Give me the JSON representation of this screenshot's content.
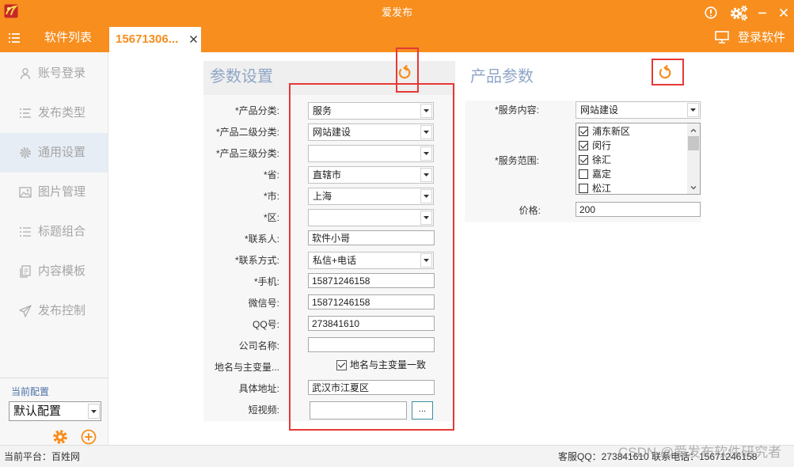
{
  "window": {
    "title": "爱发布",
    "accent_color": "#f78e1e",
    "annotation_color": "#e53935"
  },
  "topbar": {
    "list_label": "软件列表",
    "active_tab_label": "15671306...",
    "login_label": "登录软件"
  },
  "sidebar": {
    "active_index": 2,
    "items": [
      {
        "label": "账号登录",
        "icon": "user-icon"
      },
      {
        "label": "发布类型",
        "icon": "list-check-icon"
      },
      {
        "label": "通用设置",
        "icon": "gear-icon"
      },
      {
        "label": "图片管理",
        "icon": "image-icon"
      },
      {
        "label": "标题组合",
        "icon": "list-icon"
      },
      {
        "label": "内容模板",
        "icon": "document-icon"
      },
      {
        "label": "发布控制",
        "icon": "send-icon"
      }
    ],
    "config_label": "当前配置",
    "config_value": "默认配置"
  },
  "params_panel": {
    "title": "参数设置",
    "fields": [
      {
        "label": "*产品分类:",
        "value": "服务"
      },
      {
        "label": "*产品二级分类:",
        "value": "网站建设"
      },
      {
        "label": "*产品三级分类:",
        "value": ""
      },
      {
        "label": "*省:",
        "value": "直辖市"
      },
      {
        "label": "*市:",
        "value": "上海"
      },
      {
        "label": "*区:",
        "value": ""
      },
      {
        "label": "*联系人:",
        "value": "软件小哥"
      },
      {
        "label": "*联系方式:",
        "value": "私信+电话"
      },
      {
        "label": "*手机:",
        "value": "15871246158"
      },
      {
        "label": "微信号:",
        "value": "15871246158"
      },
      {
        "label": "QQ号:",
        "value": "273841610"
      },
      {
        "label": "公司名称:",
        "value": ""
      },
      {
        "label": "地名与主变量...",
        "checkbox_label": "地名与主变量一致",
        "checked": true
      },
      {
        "label": "具体地址:",
        "value": "武汉市江夏区"
      },
      {
        "label": "短视频:",
        "value": "",
        "button_label": "..."
      }
    ]
  },
  "product_panel": {
    "title": "产品参数",
    "service_content": {
      "label": "*服务内容:",
      "value": "网站建设"
    },
    "service_range": {
      "label": "*服务范围:",
      "items": [
        {
          "label": "浦东新区",
          "checked": true
        },
        {
          "label": "闵行",
          "checked": true
        },
        {
          "label": "徐汇",
          "checked": true
        },
        {
          "label": "嘉定",
          "checked": false
        },
        {
          "label": "松江",
          "checked": false
        }
      ]
    },
    "price": {
      "label": "价格:",
      "value": "200"
    }
  },
  "status_bar": {
    "platform": "当前平台：百姓网",
    "contact": "客服QQ：273841610  联系电话：15671246158",
    "watermark": "CSDN @爱发布软件研究者"
  }
}
